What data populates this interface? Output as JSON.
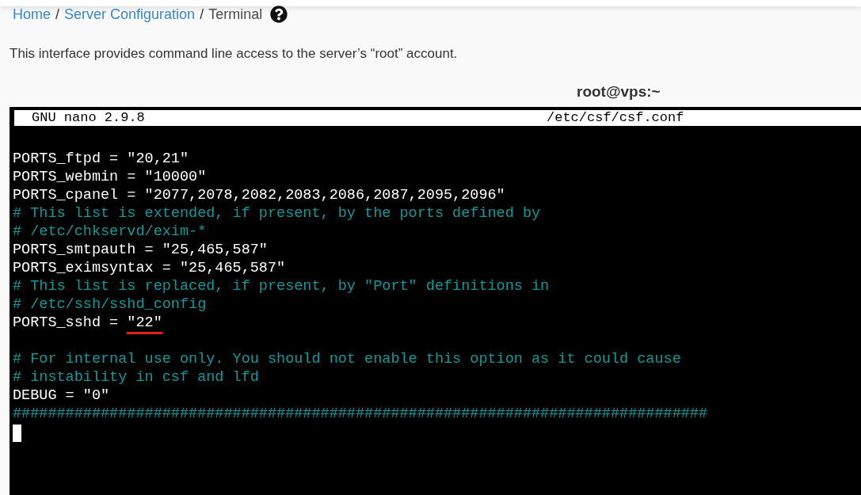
{
  "breadcrumb": [
    {
      "label": "Home",
      "link": true,
      "separator": "/"
    },
    {
      "label": "Server Configuration",
      "link": true,
      "separator": "/"
    },
    {
      "label": "Terminal",
      "link": false
    }
  ],
  "description": "This interface provides command line access to the server’s “root” account.",
  "terminal": {
    "title": "root@vps:~",
    "header": {
      "left": "GNU nano 2.9.8",
      "right": "/etc/csf/csf.conf"
    },
    "lines": [
      {
        "kind": "blank"
      },
      {
        "kind": "code",
        "text": "PORTS_ftpd = \"20,21\""
      },
      {
        "kind": "code",
        "text": "PORTS_webmin = \"10000\""
      },
      {
        "kind": "code",
        "text": "PORTS_cpanel = \"2077,2078,2082,2083,2086,2087,2095,2096\""
      },
      {
        "kind": "comment",
        "text": "# This list is extended, if present, by the ports defined by"
      },
      {
        "kind": "comment",
        "text": "# /etc/chkservd/exim-*"
      },
      {
        "kind": "code",
        "text": "PORTS_smtpauth = \"25,465,587\""
      },
      {
        "kind": "code",
        "text": "PORTS_eximsyntax = \"25,465,587\""
      },
      {
        "kind": "comment",
        "text": "# This list is replaced, if present, by \"Port\" definitions in"
      },
      {
        "kind": "comment",
        "text": "# /etc/ssh/sshd_config"
      },
      {
        "kind": "code",
        "text": "PORTS_sshd = ",
        "annotated": "\"22\""
      },
      {
        "kind": "blank"
      },
      {
        "kind": "comment",
        "text": "# For internal use only. You should not enable this option as it could cause"
      },
      {
        "kind": "comment",
        "text": "# instability in csf and lfd"
      },
      {
        "kind": "code",
        "text": "DEBUG = \"0\""
      },
      {
        "kind": "comment",
        "text": "###############################################################################"
      },
      {
        "kind": "cursor"
      }
    ]
  }
}
